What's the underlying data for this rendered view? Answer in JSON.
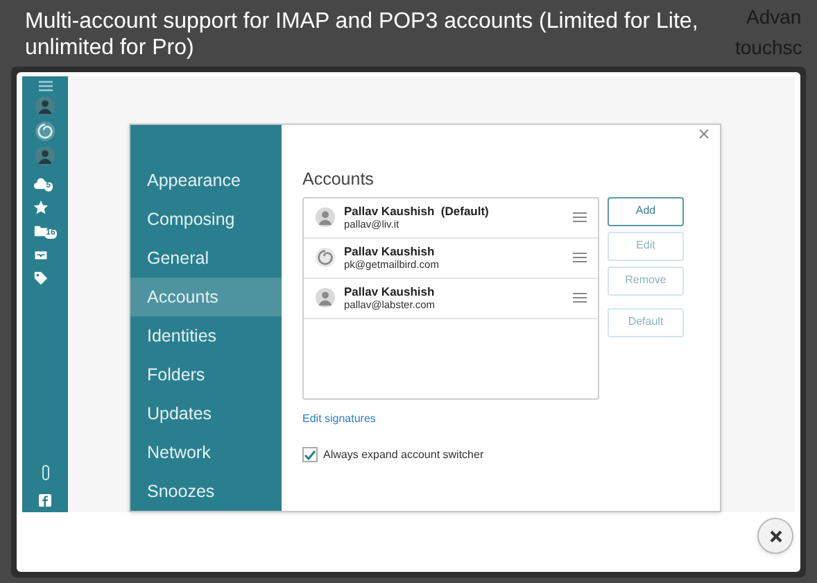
{
  "background": {
    "texts": [
      "Advan",
      "touchsc"
    ]
  },
  "caption": "Multi-account support for IMAP and POP3 accounts (Limited for Lite, unlimited for Pro)",
  "app_sidebar": {
    "accounts": [
      {
        "kind": "person"
      },
      {
        "kind": "spiral"
      },
      {
        "kind": "person"
      }
    ],
    "folders": [
      {
        "kind": "cloud",
        "badge": "5"
      },
      {
        "kind": "star"
      },
      {
        "kind": "folder",
        "badge": "16"
      },
      {
        "kind": "inbox"
      },
      {
        "kind": "tag"
      }
    ]
  },
  "settings": {
    "nav": [
      {
        "label": "Appearance",
        "selected": false
      },
      {
        "label": "Composing",
        "selected": false
      },
      {
        "label": "General",
        "selected": false
      },
      {
        "label": "Accounts",
        "selected": true
      },
      {
        "label": "Identities",
        "selected": false
      },
      {
        "label": "Folders",
        "selected": false
      },
      {
        "label": "Updates",
        "selected": false
      },
      {
        "label": "Network",
        "selected": false
      },
      {
        "label": "Snoozes",
        "selected": false
      }
    ],
    "heading": "Accounts",
    "accounts": [
      {
        "name": "Pallav Kaushish  (Default)",
        "email": "pallav@liv.it",
        "kind": "person"
      },
      {
        "name": "Pallav Kaushish",
        "email": "pk@getmailbird.com",
        "kind": "spiral"
      },
      {
        "name": "Pallav Kaushish",
        "email": "pallav@labster.com",
        "kind": "person"
      }
    ],
    "buttons": [
      {
        "label": "Add",
        "disabled": false
      },
      {
        "label": "Edit",
        "disabled": true
      },
      {
        "label": "Remove",
        "disabled": true
      },
      {
        "label": "Default",
        "disabled": true
      }
    ],
    "link": "Edit signatures",
    "checkbox": {
      "label": "Always expand account switcher",
      "checked": true
    }
  }
}
